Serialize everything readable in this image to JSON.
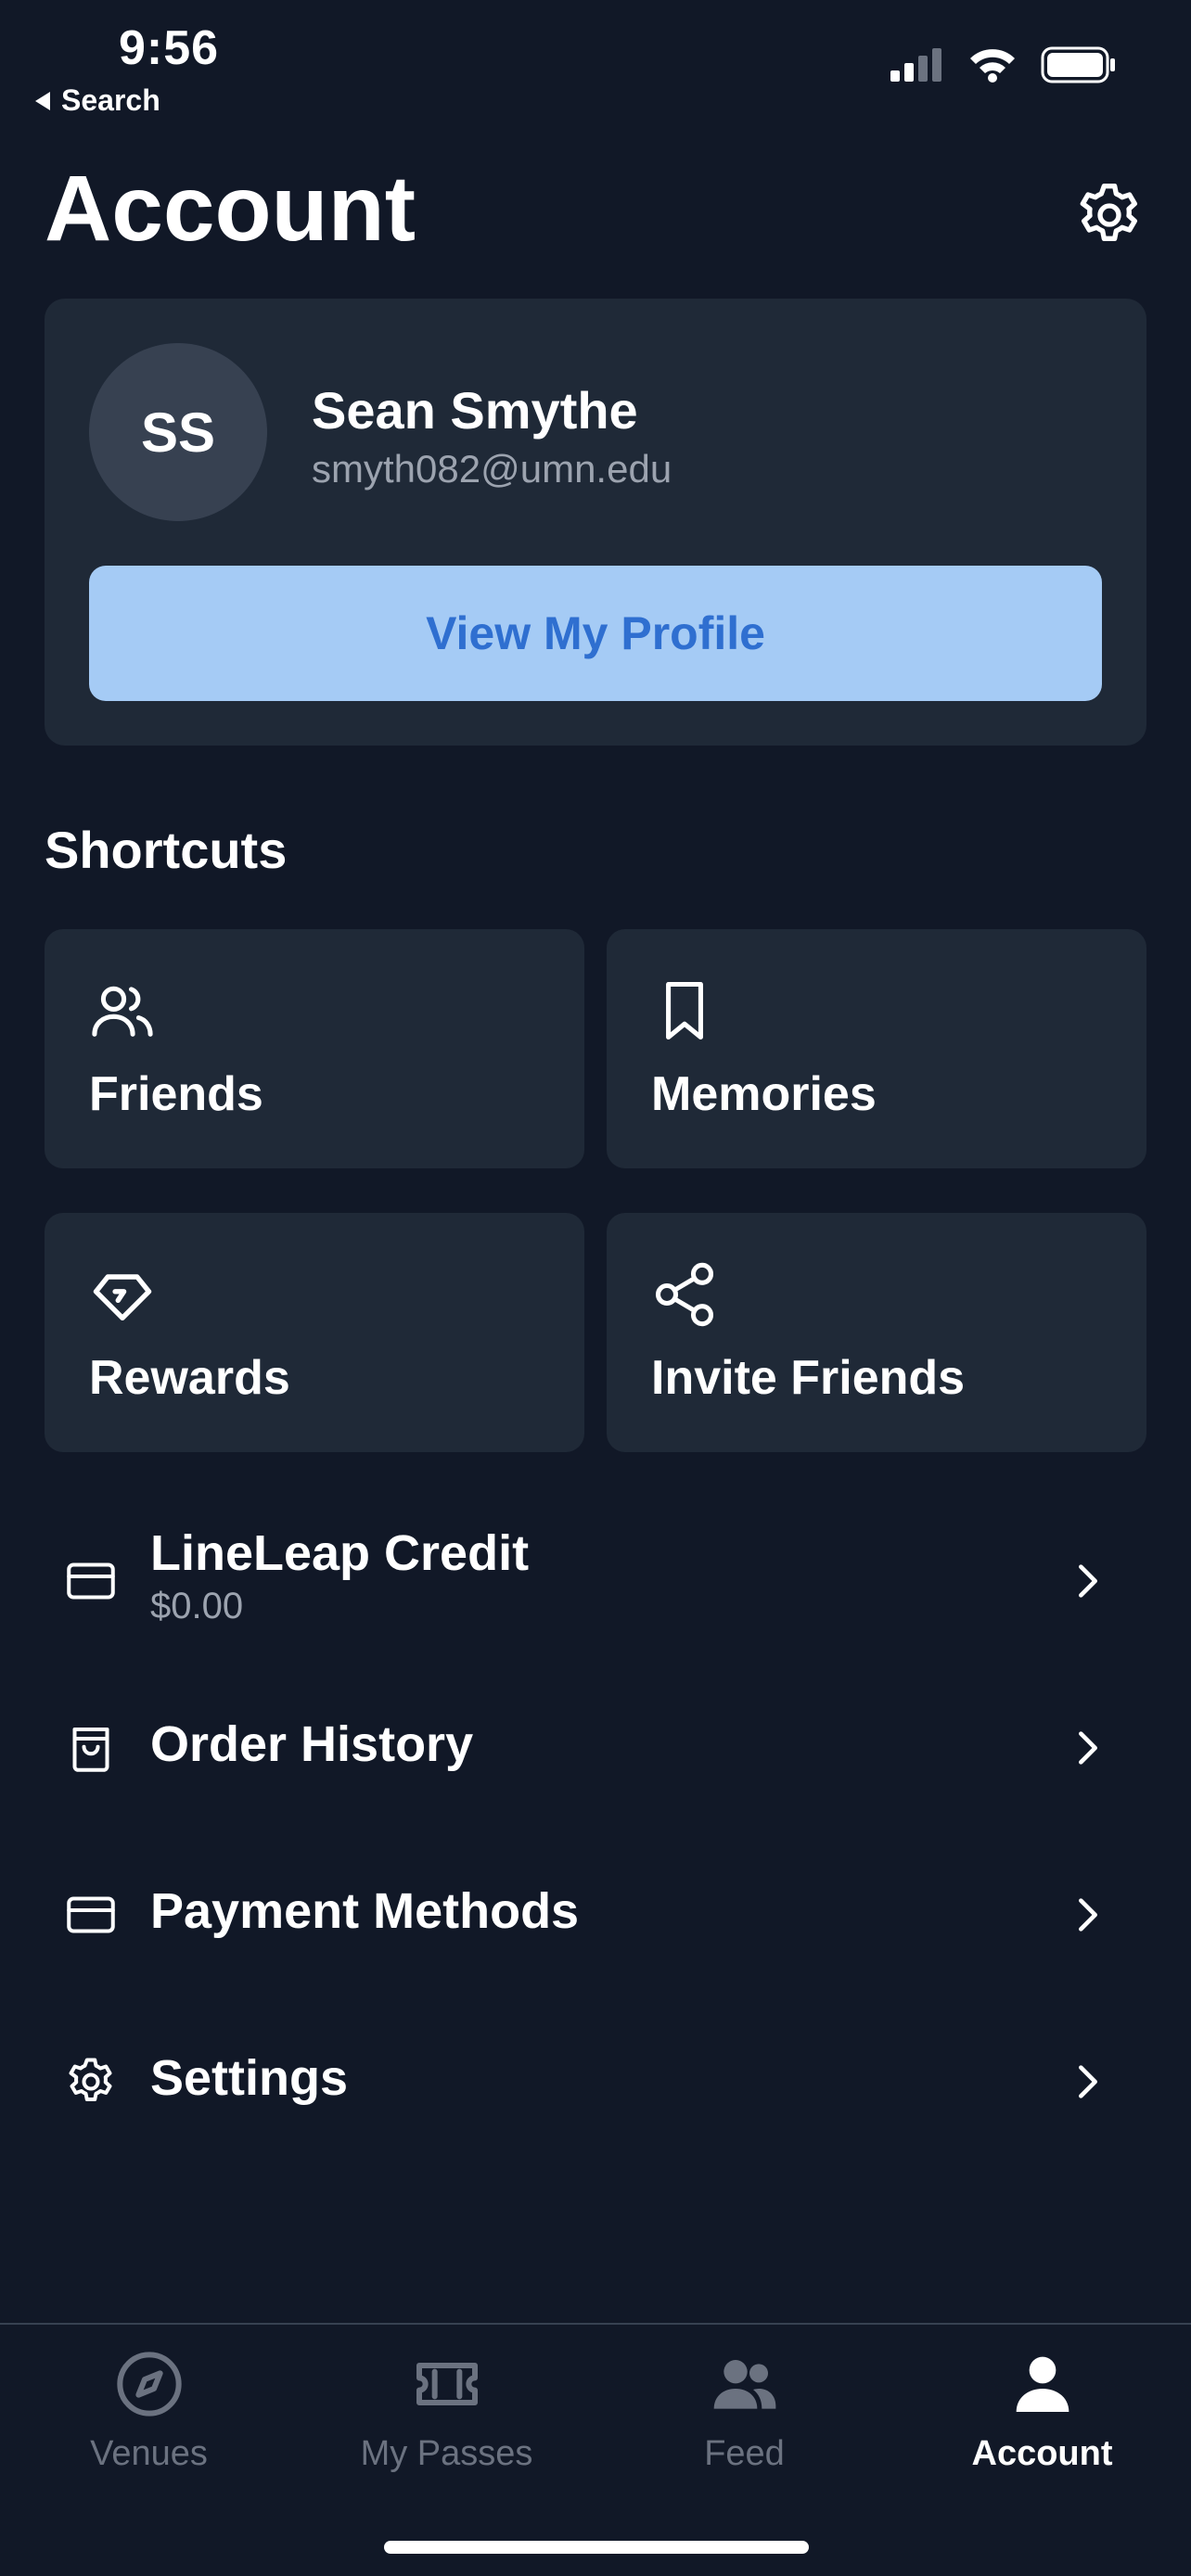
{
  "status_bar": {
    "time": "9:56",
    "back_label": "Search"
  },
  "header": {
    "title": "Account"
  },
  "profile": {
    "initials": "SS",
    "name": "Sean Smythe",
    "email": "smyth082@umn.edu",
    "button_label": "View My Profile"
  },
  "shortcuts": {
    "title": "Shortcuts",
    "items": [
      {
        "label": "Friends",
        "icon": "friends-icon"
      },
      {
        "label": "Memories",
        "icon": "bookmark-icon"
      },
      {
        "label": "Rewards",
        "icon": "diamond-icon"
      },
      {
        "label": "Invite Friends",
        "icon": "share-icon"
      }
    ]
  },
  "menu": {
    "items": [
      {
        "label": "LineLeap Credit",
        "sublabel": "$0.00",
        "icon": "credit-card-icon"
      },
      {
        "label": "Order History",
        "icon": "shopping-bag-icon"
      },
      {
        "label": "Payment Methods",
        "icon": "credit-card-icon"
      },
      {
        "label": "Settings",
        "icon": "gear-icon"
      }
    ]
  },
  "tabbar": {
    "items": [
      {
        "label": "Venues",
        "icon": "compass-icon",
        "active": false
      },
      {
        "label": "My Passes",
        "icon": "ticket-icon",
        "active": false
      },
      {
        "label": "Feed",
        "icon": "people-icon",
        "active": false
      },
      {
        "label": "Account",
        "icon": "user-icon",
        "active": true
      }
    ]
  },
  "colors": {
    "background": "#111827",
    "card": "#1f2937",
    "profile_button": "#a5cbf5",
    "profile_button_text": "#2f6fd0",
    "muted_text": "#9ca3af",
    "inactive_tab": "#6b7280"
  }
}
